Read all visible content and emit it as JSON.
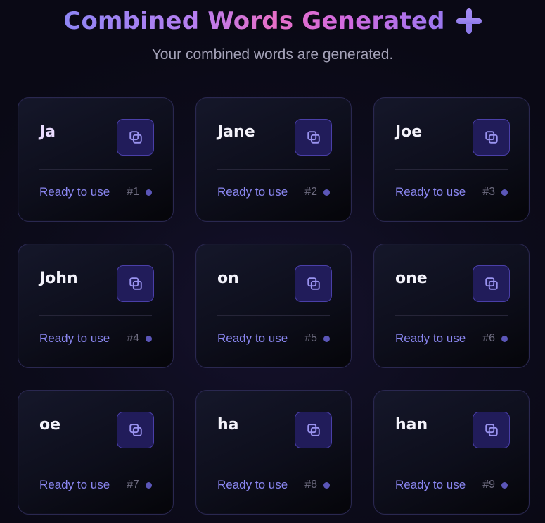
{
  "header": {
    "title": "Combined Words Generated",
    "title_icon": "plus-icon",
    "subtitle": "Your combined words are generated."
  },
  "colors": {
    "title_gradient_start": "#8f86f5",
    "title_gradient_mid": "#e76fc7",
    "accent": "#8a86f0",
    "copy_button_bg": "#211c5a",
    "copy_button_border": "#4a3fa8",
    "status_dot": "#5b56b8",
    "card_border": "#2a2850"
  },
  "cards": [
    {
      "word": "Ja",
      "status": "Ready to use",
      "index": "#1",
      "icon": "copy-icon"
    },
    {
      "word": "Jane",
      "status": "Ready to use",
      "index": "#2",
      "icon": "copy-icon"
    },
    {
      "word": "Joe",
      "status": "Ready to use",
      "index": "#3",
      "icon": "copy-icon"
    },
    {
      "word": "John",
      "status": "Ready to use",
      "index": "#4",
      "icon": "copy-icon"
    },
    {
      "word": "on",
      "status": "Ready to use",
      "index": "#5",
      "icon": "copy-icon"
    },
    {
      "word": "one",
      "status": "Ready to use",
      "index": "#6",
      "icon": "copy-icon"
    },
    {
      "word": "oe",
      "status": "Ready to use",
      "index": "#7",
      "icon": "copy-icon"
    },
    {
      "word": "ha",
      "status": "Ready to use",
      "index": "#8",
      "icon": "copy-icon"
    },
    {
      "word": "han",
      "status": "Ready to use",
      "index": "#9",
      "icon": "copy-icon"
    }
  ]
}
